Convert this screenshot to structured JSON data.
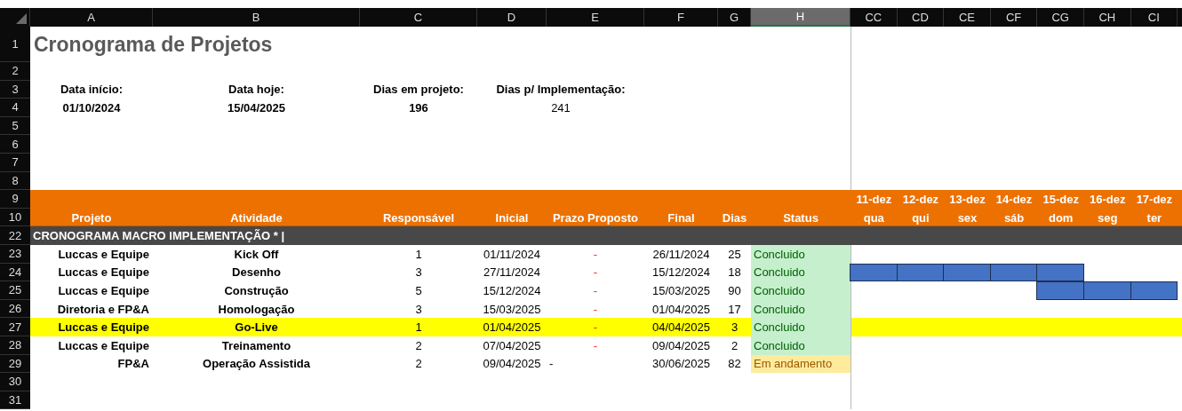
{
  "column_headers": [
    {
      "label": "A",
      "selected": false
    },
    {
      "label": "B",
      "selected": false
    },
    {
      "label": "C",
      "selected": false
    },
    {
      "label": "D",
      "selected": false
    },
    {
      "label": "E",
      "selected": false
    },
    {
      "label": "F",
      "selected": false
    },
    {
      "label": "G",
      "selected": false
    },
    {
      "label": "H",
      "selected": true
    },
    {
      "label": "CC",
      "selected": false
    },
    {
      "label": "CD",
      "selected": false
    },
    {
      "label": "CE",
      "selected": false
    },
    {
      "label": "CF",
      "selected": false
    },
    {
      "label": "CG",
      "selected": false
    },
    {
      "label": "CH",
      "selected": false
    },
    {
      "label": "CI",
      "selected": false
    }
  ],
  "row_numbers": [
    "1",
    "2",
    "3",
    "4",
    "5",
    "6",
    "7",
    "8",
    "9",
    "10",
    "22",
    "23",
    "24",
    "25",
    "26",
    "27",
    "28",
    "29",
    "30",
    "31"
  ],
  "title": "Cronograma de Projetos",
  "summary": [
    {
      "label": "Data início:",
      "value": "01/10/2024",
      "bold": true
    },
    {
      "label": "Data hoje:",
      "value": "15/04/2025",
      "bold": true
    },
    {
      "label": "Dias em projeto:",
      "value": "196",
      "bold": true
    },
    {
      "label": "Dias p/ Implementação:",
      "value": "241",
      "bold": false
    }
  ],
  "table": {
    "columns": [
      "Projeto",
      "Atividade",
      "Responsável",
      "Inicial",
      "Prazo Proposto",
      "Final",
      "Dias",
      "Status"
    ],
    "timeline": [
      {
        "date": "11-dez",
        "weekday": "qua"
      },
      {
        "date": "12-dez",
        "weekday": "qui"
      },
      {
        "date": "13-dez",
        "weekday": "sex"
      },
      {
        "date": "14-dez",
        "weekday": "sáb"
      },
      {
        "date": "15-dez",
        "weekday": "dom"
      },
      {
        "date": "16-dez",
        "weekday": "seg"
      },
      {
        "date": "17-dez",
        "weekday": "ter"
      }
    ],
    "section": "CRONOGRAMA MACRO IMPLEMENTAÇÃO * |",
    "rows": [
      {
        "projeto": "Luccas e Equipe",
        "atividade": "Kick Off",
        "responsavel": "1",
        "inicial": "01/11/2024",
        "prazo": "-",
        "prazo_flagged": true,
        "final": "26/11/2024",
        "dias": "25",
        "status": "Concluido",
        "kind": "done",
        "highlighted": false,
        "timeline": [
          false,
          false,
          false,
          false,
          false,
          false,
          false
        ]
      },
      {
        "projeto": "Luccas e Equipe",
        "atividade": "Desenho",
        "responsavel": "3",
        "inicial": "27/11/2024",
        "prazo": "-",
        "prazo_flagged": true,
        "final": "15/12/2024",
        "dias": "18",
        "status": "Concluido",
        "kind": "done",
        "highlighted": false,
        "timeline": [
          true,
          true,
          true,
          true,
          true,
          false,
          false
        ]
      },
      {
        "projeto": "Luccas e Equipe",
        "atividade": "Construção",
        "responsavel": "5",
        "inicial": "15/12/2024",
        "prazo": "-",
        "prazo_flagged": true,
        "final": "15/03/2025",
        "dias": "90",
        "status": "Concluido",
        "kind": "done",
        "highlighted": false,
        "timeline": [
          false,
          false,
          false,
          false,
          true,
          true,
          true
        ]
      },
      {
        "projeto": "Diretoria e FP&A",
        "atividade": "Homologação",
        "responsavel": "3",
        "inicial": "15/03/2025",
        "prazo": "-",
        "prazo_flagged": true,
        "final": "01/04/2025",
        "dias": "17",
        "status": "Concluido",
        "kind": "done",
        "highlighted": false,
        "timeline": [
          false,
          false,
          false,
          false,
          false,
          false,
          false
        ]
      },
      {
        "projeto": "Luccas e Equipe",
        "atividade": "Go-Live",
        "responsavel": "1",
        "inicial": "01/04/2025",
        "prazo": "-",
        "prazo_flagged": true,
        "final": "04/04/2025",
        "dias": "3",
        "status": "Concluido",
        "kind": "done",
        "highlighted": true,
        "timeline": [
          false,
          false,
          false,
          false,
          false,
          false,
          false
        ]
      },
      {
        "projeto": "Luccas e Equipe",
        "atividade": "Treinamento",
        "responsavel": "2",
        "inicial": "07/04/2025",
        "prazo": "-",
        "prazo_flagged": true,
        "final": "09/04/2025",
        "dias": "2",
        "status": "Concluido",
        "kind": "done",
        "highlighted": false,
        "timeline": [
          false,
          false,
          false,
          false,
          false,
          false,
          false
        ]
      },
      {
        "projeto": "FP&A",
        "atividade": "Operação Assistida",
        "responsavel": "2",
        "inicial": "09/04/2025",
        "prazo": "-",
        "prazo_flagged": false,
        "final": "30/06/2025",
        "dias": "82",
        "status": "Em andamento",
        "kind": "in_progress",
        "highlighted": false,
        "timeline": [
          false,
          false,
          false,
          false,
          false,
          false,
          false
        ]
      }
    ]
  }
}
